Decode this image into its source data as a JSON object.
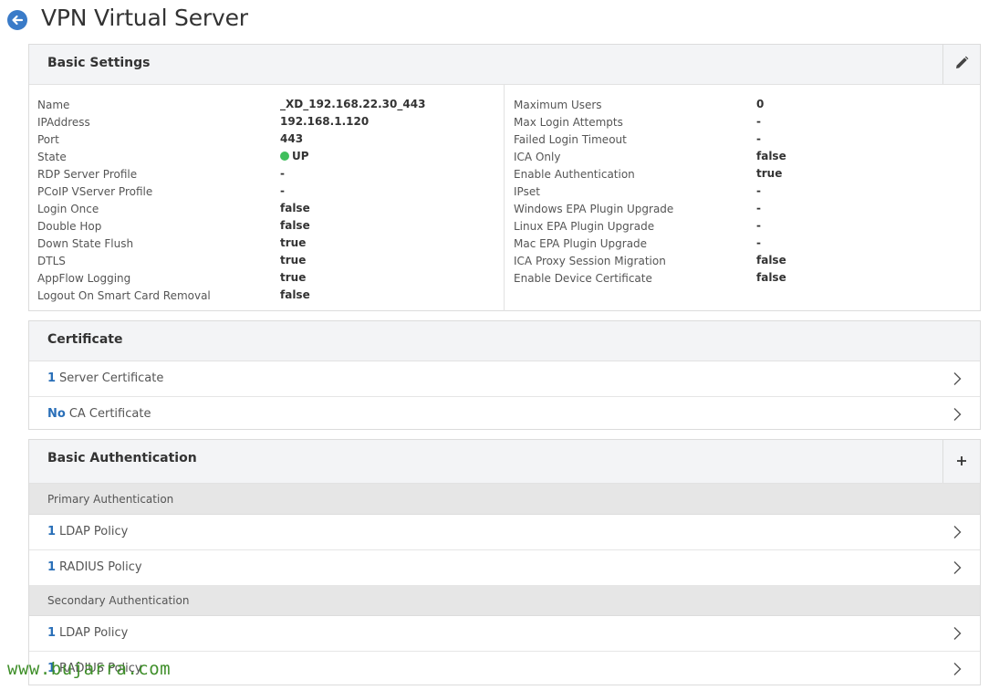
{
  "header": {
    "title": "VPN Virtual Server",
    "back_icon": "arrow-left-icon",
    "accent": "#3a7bc8"
  },
  "basic_settings": {
    "title": "Basic Settings",
    "edit_icon": "pencil-icon",
    "left": [
      {
        "label": "Name",
        "value": "_XD_192.168.22.30_443"
      },
      {
        "label": "IPAddress",
        "value": "192.168.1.120"
      },
      {
        "label": "Port",
        "value": "443"
      },
      {
        "label": "State",
        "value": "UP",
        "status_color": "#3fbf5c"
      },
      {
        "label": "RDP Server Profile",
        "value": "-"
      },
      {
        "label": "PCoIP VServer Profile",
        "value": "-"
      },
      {
        "label": "Login Once",
        "value": "false"
      },
      {
        "label": "Double Hop",
        "value": "false"
      },
      {
        "label": "Down State Flush",
        "value": "true"
      },
      {
        "label": "DTLS",
        "value": "true"
      },
      {
        "label": "AppFlow Logging",
        "value": "true"
      },
      {
        "label": "Logout On Smart Card Removal",
        "value": "false"
      }
    ],
    "right": [
      {
        "label": "Maximum Users",
        "value": "0"
      },
      {
        "label": "Max Login Attempts",
        "value": "-"
      },
      {
        "label": "Failed Login Timeout",
        "value": "-"
      },
      {
        "label": "ICA Only",
        "value": "false"
      },
      {
        "label": "Enable Authentication",
        "value": "true"
      },
      {
        "label": "IPset",
        "value": "-"
      },
      {
        "label": "Windows EPA Plugin Upgrade",
        "value": "-"
      },
      {
        "label": "Linux EPA Plugin Upgrade",
        "value": "-"
      },
      {
        "label": "Mac EPA Plugin Upgrade",
        "value": "-"
      },
      {
        "label": "ICA Proxy Session Migration",
        "value": "false"
      },
      {
        "label": "Enable Device Certificate",
        "value": "false"
      }
    ]
  },
  "certificate": {
    "title": "Certificate",
    "rows": [
      {
        "count": "1",
        "label": "Server Certificate"
      },
      {
        "count": "No",
        "label": "CA Certificate"
      }
    ]
  },
  "basic_authentication": {
    "title": "Basic Authentication",
    "add_icon": "plus-icon",
    "primary": {
      "label": "Primary Authentication",
      "rows": [
        {
          "count": "1",
          "label": "LDAP Policy"
        },
        {
          "count": "1",
          "label": "RADIUS Policy"
        }
      ]
    },
    "secondary": {
      "label": "Secondary Authentication",
      "rows": [
        {
          "count": "1",
          "label": "LDAP Policy"
        },
        {
          "count": "1",
          "label": "RADIUS Policy"
        }
      ]
    }
  },
  "watermark": "www.bujarra.com"
}
